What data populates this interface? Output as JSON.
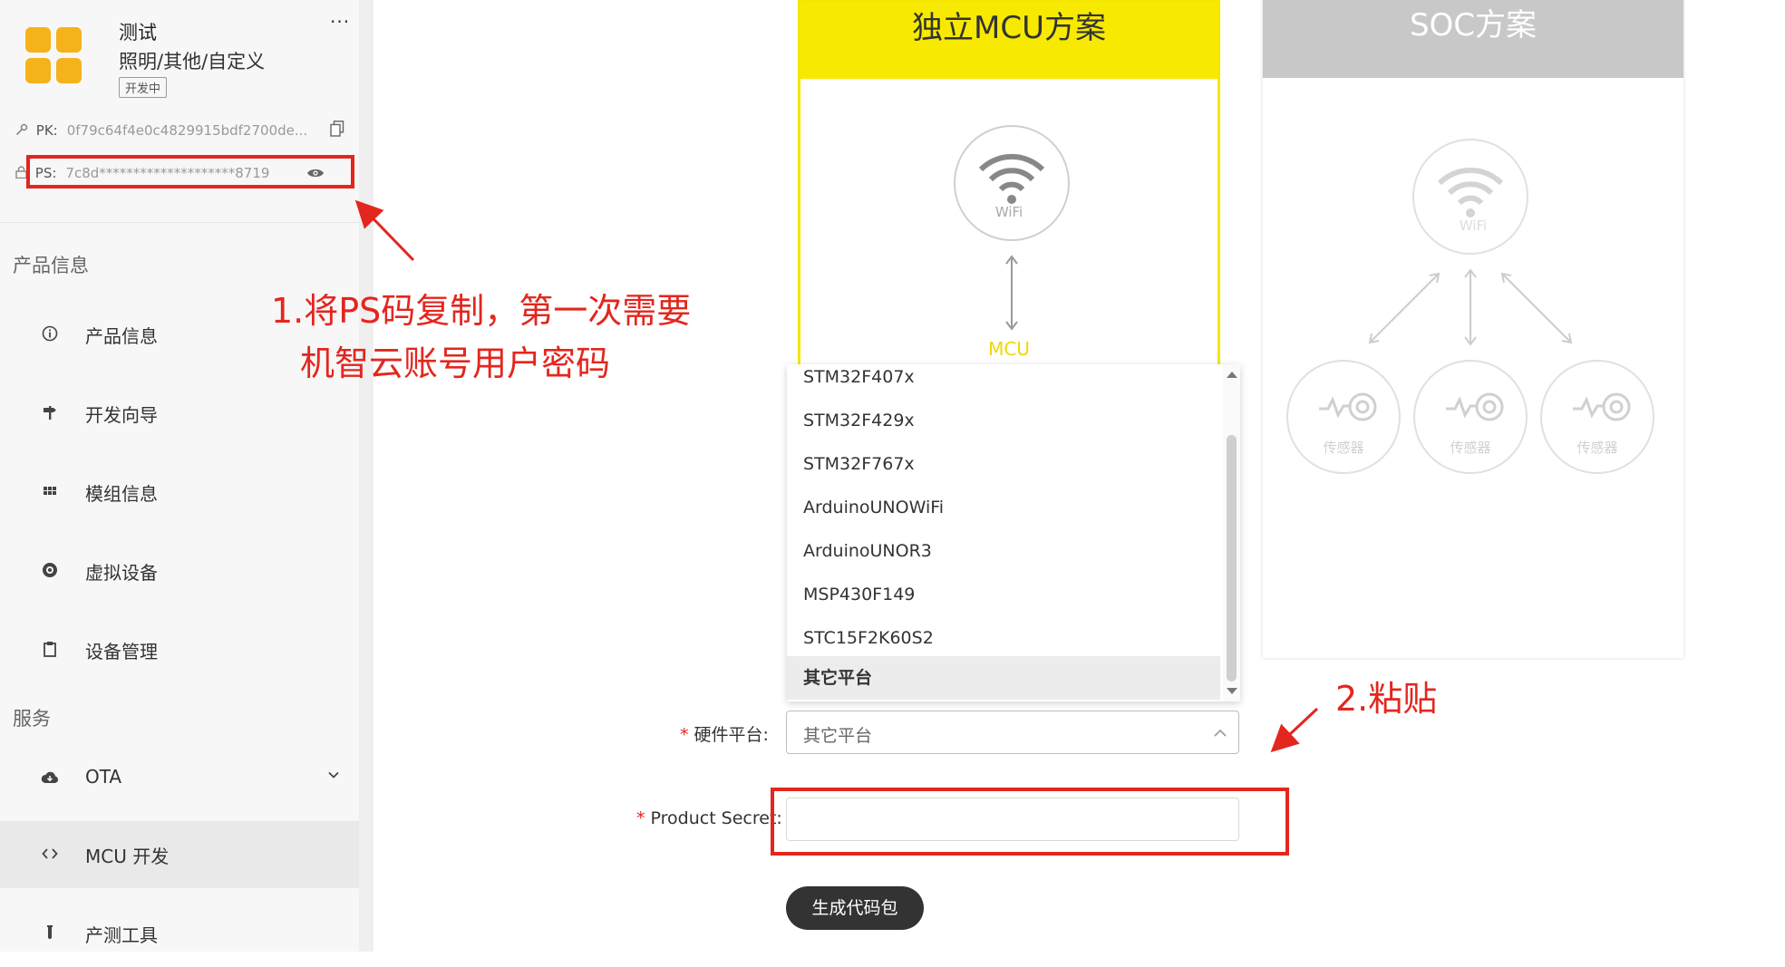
{
  "product": {
    "name": "测试",
    "category": "照明/其他/自定义",
    "status_badge": "开发中",
    "more": "···",
    "pk_label": "PK:",
    "pk_value": "0f79c64f4e0c4829915bdf2700de...",
    "ps_label": "PS:",
    "ps_value": "7c8d********************8719"
  },
  "sidebar": {
    "section_product": "产品信息",
    "section_service": "服务",
    "items": [
      {
        "label": "产品信息",
        "icon": "info-icon"
      },
      {
        "label": "开发向导",
        "icon": "signpost-icon"
      },
      {
        "label": "模组信息",
        "icon": "grid-icon"
      },
      {
        "label": "虚拟设备",
        "icon": "virtual-device-icon"
      },
      {
        "label": "设备管理",
        "icon": "clipboard-icon"
      },
      {
        "label": "OTA",
        "icon": "cloud-download-icon"
      },
      {
        "label": "MCU 开发",
        "icon": "code-icon"
      },
      {
        "label": "产测工具",
        "icon": "test-tube-icon"
      }
    ]
  },
  "annotations": {
    "step1_line1": "1.将PS码复制，第一次需要",
    "step1_line2": "机智云账号用户密码",
    "step2": "2.粘贴"
  },
  "cards": {
    "mcu": {
      "title": "独立MCU方案",
      "wifi_label": "WiFi",
      "mcu_label": "MCU"
    },
    "soc": {
      "title": "SOC方案",
      "wifi_label": "WiFi",
      "sensor_label": "传感器"
    }
  },
  "form": {
    "hardware_label": "硬件平台:",
    "hardware_value": "其它平台",
    "secret_label": "Product Secret:",
    "secret_value": "",
    "generate_button": "生成代码包",
    "options": [
      "STM32F407x",
      "STM32F429x",
      "STM32F767x",
      "ArduinoUNOWiFi",
      "ArduinoUNOR3",
      "MSP430F149",
      "STC15F2K60S2",
      "其它平台"
    ],
    "selected_option": "其它平台"
  },
  "colors": {
    "accent_yellow": "#f7ea00",
    "annotation_red": "#e3261e",
    "button_dark": "#333333",
    "logo_orange": "#f6b21a"
  }
}
